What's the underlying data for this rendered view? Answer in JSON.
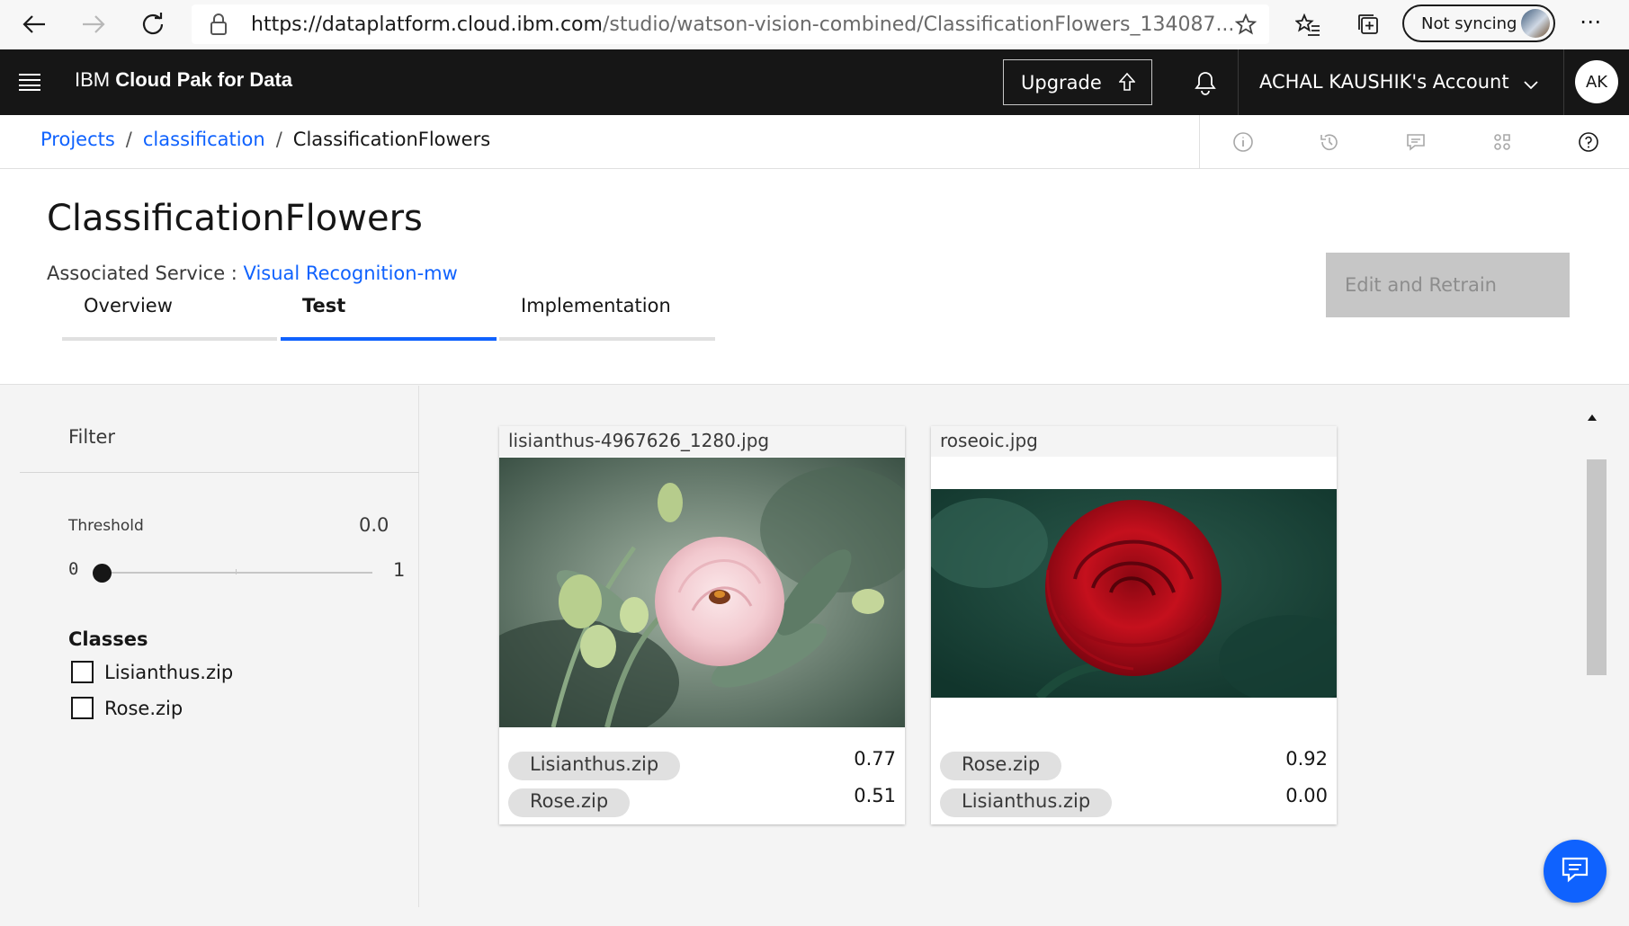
{
  "browser": {
    "url_main": "https://dataplatform.cloud.ibm.com",
    "url_rest": "/studio/watson-vision-combined/ClassificationFlowers_134087...",
    "sync_label": "Not syncing"
  },
  "topnav": {
    "brand_prefix": "IBM ",
    "brand_bold": "Cloud Pak for Data",
    "upgrade_label": "Upgrade",
    "account_label": "ACHAL KAUSHIK's Account",
    "avatar_initials": "AK"
  },
  "breadcrumb": {
    "items": [
      "Projects",
      "classification",
      "ClassificationFlowers"
    ],
    "separator": "/"
  },
  "header": {
    "title": "ClassificationFlowers",
    "assoc_label": "Associated Service : ",
    "assoc_link": "Visual Recognition-mw",
    "retrain_label": "Edit and Retrain",
    "tabs": [
      "Overview",
      "Test",
      "Implementation"
    ],
    "active_tab": "Test"
  },
  "filter": {
    "title": "Filter",
    "threshold_label": "Threshold",
    "threshold_value": "0.0",
    "slider_min": "0",
    "slider_max": "1",
    "slider_fraction": 0.0,
    "classes_title": "Classes",
    "classes": [
      "Lisianthus.zip",
      "Rose.zip"
    ]
  },
  "results": [
    {
      "filename": "lisianthus-4967626_1280.jpg",
      "scores": [
        {
          "label": "Lisianthus.zip",
          "score": "0.77"
        },
        {
          "label": "Rose.zip",
          "score": "0.51"
        }
      ]
    },
    {
      "filename": "roseoic.jpg",
      "scores": [
        {
          "label": "Rose.zip",
          "score": "0.92"
        },
        {
          "label": "Lisianthus.zip",
          "score": "0.00"
        }
      ]
    }
  ],
  "colors": {
    "accent": "#0f62fe",
    "topnav_bg": "#161616",
    "page_bg": "#f4f4f4"
  }
}
